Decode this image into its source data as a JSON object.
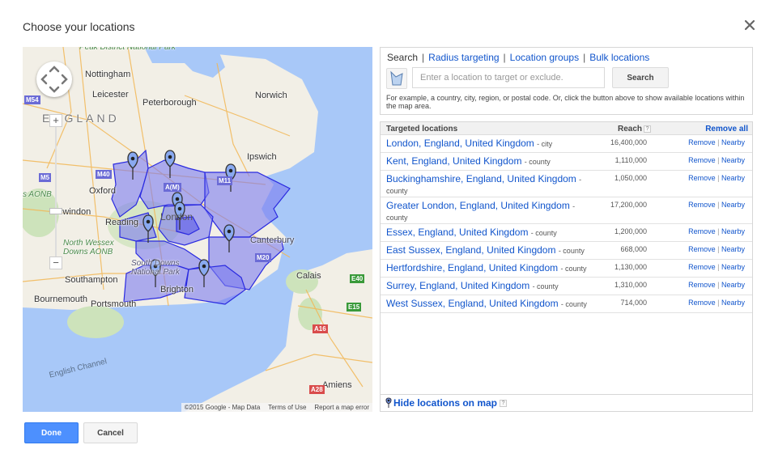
{
  "dialog": {
    "title": "Choose your locations",
    "close_icon": "close-icon"
  },
  "search": {
    "tabs": [
      {
        "label": "Search",
        "active": true
      },
      {
        "label": "Radius targeting",
        "active": false
      },
      {
        "label": "Location groups",
        "active": false
      },
      {
        "label": "Bulk locations",
        "active": false
      }
    ],
    "tab_separator": "|",
    "map_area_icon": "map-area-icon",
    "input_value": "",
    "input_placeholder": "Enter a location to target or exclude.",
    "button_label": "Search",
    "hint": "For example, a country, city, region, or postal code. Or, click the button above to show available locations within the map area."
  },
  "targets": {
    "header": {
      "name": "Targeted locations",
      "reach": "Reach",
      "help": "?",
      "remove_all": "Remove all"
    },
    "action_remove": "Remove",
    "action_sep": "|",
    "action_nearby": "Nearby",
    "rows": [
      {
        "name": "London, England, United Kingdom",
        "type": "- city",
        "reach": "16,400,000"
      },
      {
        "name": "Kent, England, United Kingdom",
        "type": "- county",
        "reach": "1,110,000"
      },
      {
        "name": "Buckinghamshire, England, United Kingdom",
        "type": "- county",
        "reach": "1,050,000"
      },
      {
        "name": "Greater London, England, United Kingdom",
        "type": "- county",
        "reach": "17,200,000"
      },
      {
        "name": "Essex, England, United Kingdom",
        "type": "- county",
        "reach": "1,200,000"
      },
      {
        "name": "East Sussex, England, United Kingdom",
        "type": "- county",
        "reach": "668,000"
      },
      {
        "name": "Hertfordshire, England, United Kingdom",
        "type": "- county",
        "reach": "1,130,000"
      },
      {
        "name": "Surrey, England, United Kingdom",
        "type": "- county",
        "reach": "1,310,000"
      },
      {
        "name": "West Sussex, England, United Kingdom",
        "type": "- county",
        "reach": "714,000"
      }
    ],
    "footer": {
      "hide_link": "Hide locations on map",
      "help": "?"
    }
  },
  "map": {
    "labels": {
      "peak": "Peak District National Park",
      "nottingham": "Nottingham",
      "leicester": "Leicester",
      "peterborough": "Peterborough",
      "norwich": "Norwich",
      "england": "ENGLAND",
      "ipswich": "Ipswich",
      "oxford": "Oxford",
      "swindon": "Swindon",
      "reading": "Reading",
      "london": "London",
      "north_wessex": "North Wessex",
      "downs_aonb": "Downs AONB",
      "cotswolds_aonb": "s AONB",
      "canterbury": "Canterbury",
      "south_downs": "South Downs",
      "national_park": "National Park",
      "southampton": "Southampton",
      "brighton": "Brighton",
      "bournemouth": "Bournemouth",
      "portsmouth": "Portsmouth",
      "calais": "Calais",
      "english_channel": "English Channel",
      "amiens": "Amiens"
    },
    "roads": {
      "m54": "M54",
      "m5": "M5",
      "m40": "M40",
      "m11": "M11",
      "am": "A(M)",
      "m20": "M20",
      "e40": "E40",
      "e15": "E15",
      "a16": "A16",
      "a28": "A28"
    },
    "zoom_in": "+",
    "zoom_out": "−",
    "footer": {
      "copyright": "©2015 Google - Map Data",
      "terms": "Terms of Use",
      "report": "Report a map error"
    },
    "colors": {
      "sea": "#a8c8f8",
      "land": "#f2efe6",
      "region_fill": "#7b7bf0",
      "region_stroke": "#2a2ae0"
    }
  },
  "actions": {
    "done": "Done",
    "cancel": "Cancel"
  }
}
